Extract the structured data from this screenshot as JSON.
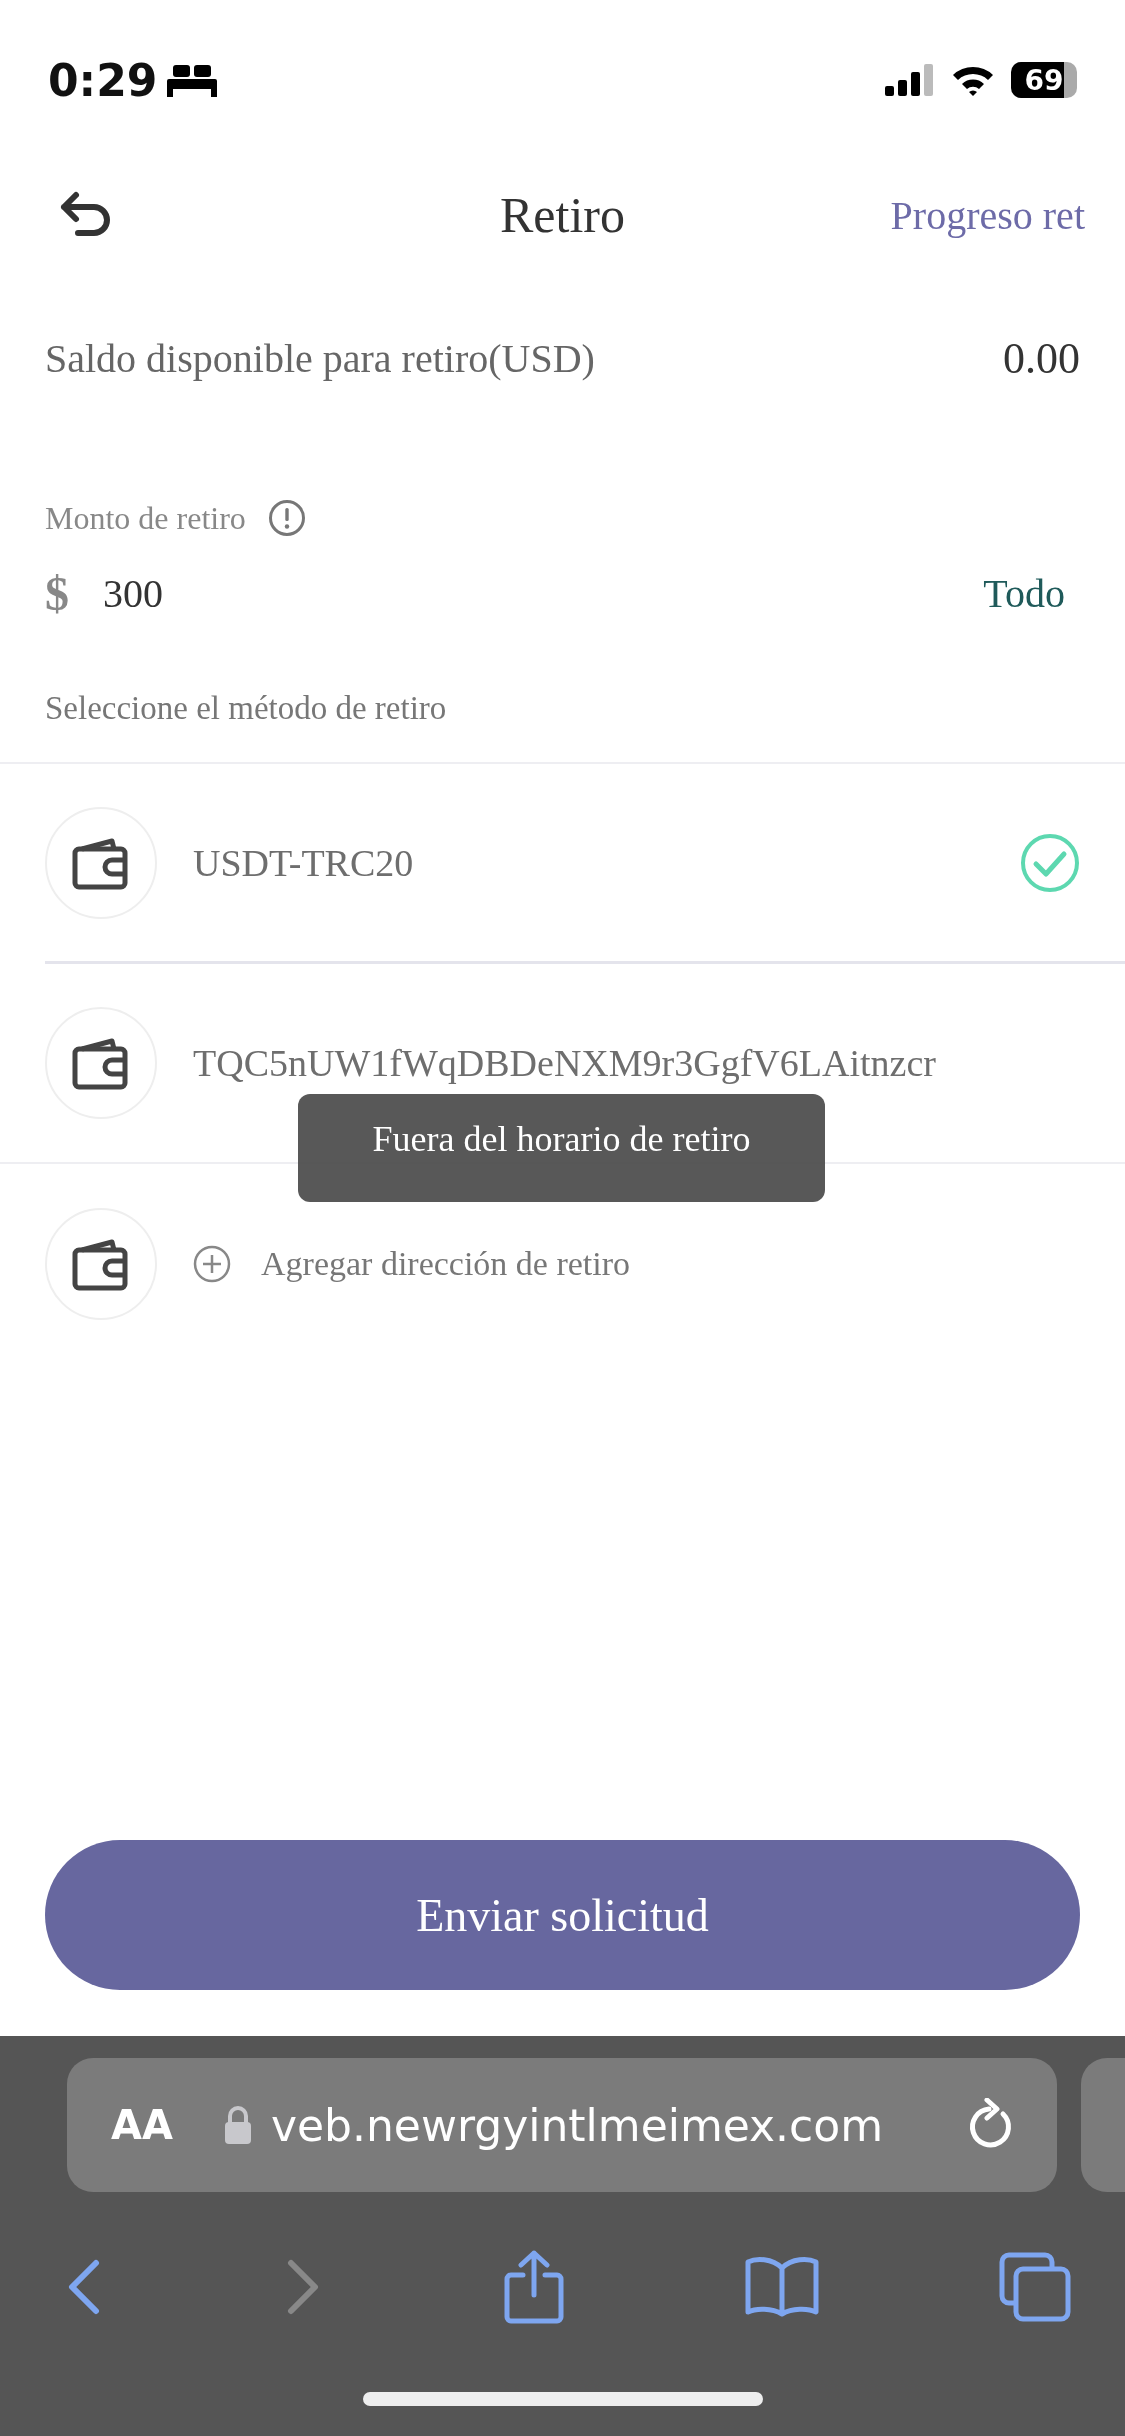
{
  "status_bar": {
    "time": "0:29",
    "battery": "69"
  },
  "header": {
    "title": "Retiro",
    "action": "Progreso ret"
  },
  "balance": {
    "label": "Saldo disponible para retiro(USD)",
    "value": "0.00"
  },
  "amount": {
    "label": "Monto de retiro",
    "currency": "$",
    "value": "300",
    "all_button": "Todo"
  },
  "methods_title": "Seleccione el método de retiro",
  "methods": [
    {
      "kind": "method",
      "label": "USDT-TRC20",
      "selected": true
    },
    {
      "kind": "method",
      "label": "TQC5nUW1fWqDBDeNXM9r3GgfV6LAitnzcr",
      "selected": false
    },
    {
      "kind": "add",
      "label": "Agregar dirección de retiro"
    }
  ],
  "toast": "Fuera del horario de retiro",
  "submit": "Enviar solicitud",
  "browser": {
    "text_size": "AA",
    "url": "veb.newrgyintlmeimex.com"
  }
}
